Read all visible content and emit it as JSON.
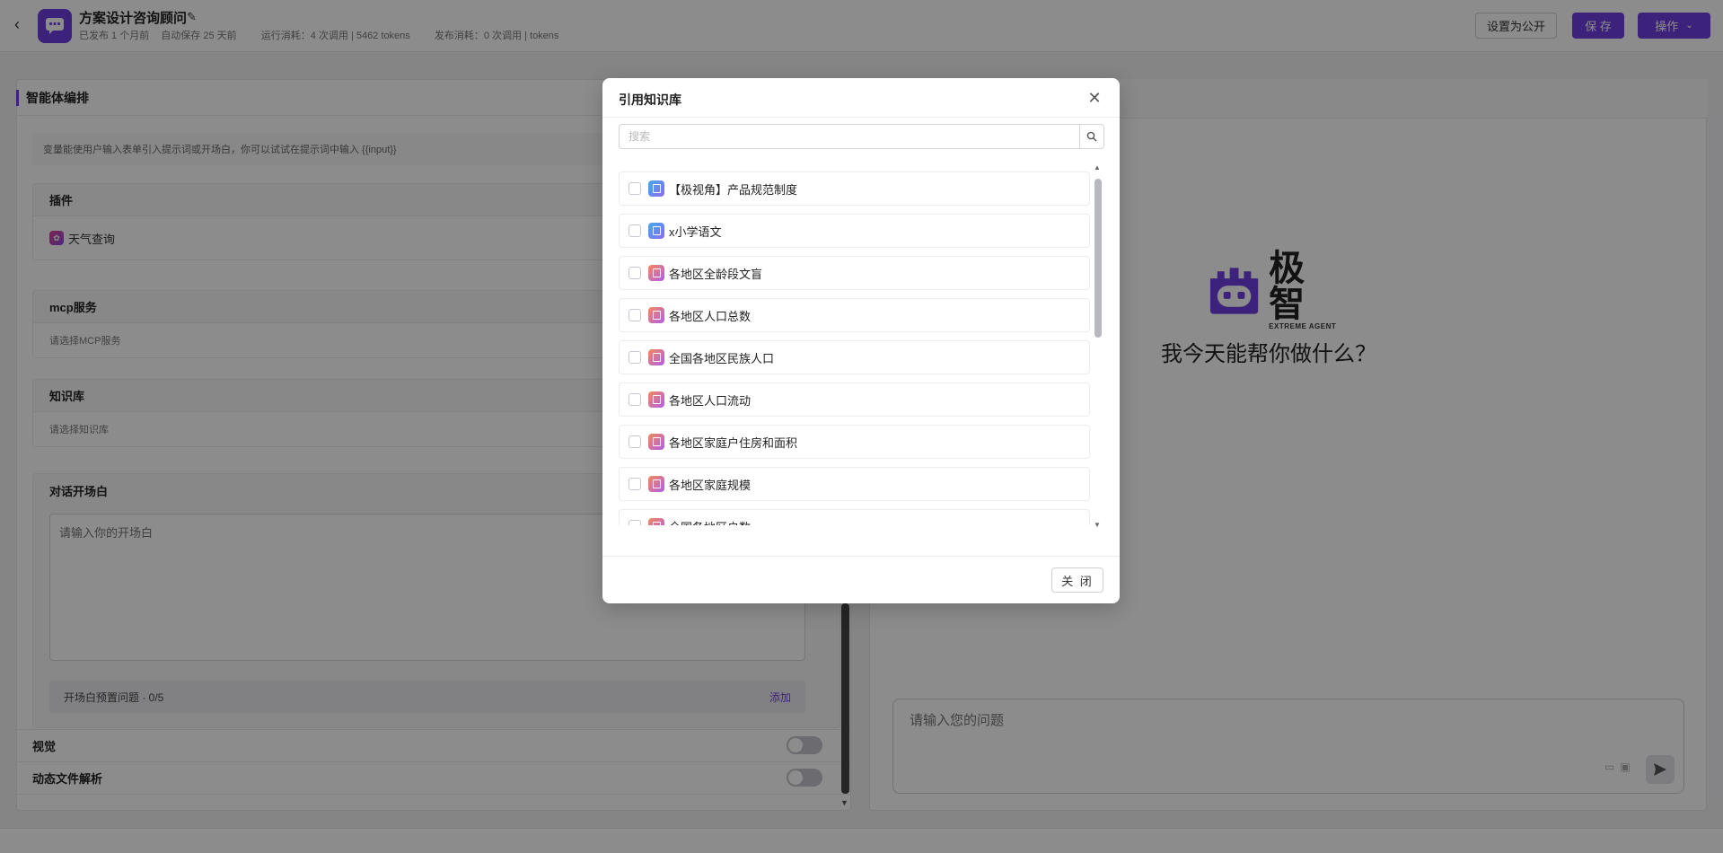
{
  "header": {
    "title": "方案设计咨询顾问",
    "published": "已发布 1 个月前",
    "autosave": "自动保存 25 天前",
    "run_cost": "运行消耗：4 次调用 | 5462 tokens",
    "publish_cost": "发布消耗：0 次调用 | tokens",
    "public_label": "设置为公开",
    "save_label": "保 存",
    "ops_label": "操作"
  },
  "left": {
    "title": "智能体编排",
    "hint": "变量能使用户输入表单引入提示词或开场白，你可以试试在提示词中输入 {{input}}",
    "plugins": {
      "title": "插件",
      "item": "天气查询"
    },
    "mcp": {
      "title": "mcp服务",
      "placeholder": "请选择MCP服务"
    },
    "knowledge": {
      "title": "知识库",
      "placeholder": "请选择知识库"
    },
    "opener": {
      "title": "对话开场白",
      "placeholder": "请输入你的开场白",
      "preset": "开场白预置问题 · 0/5",
      "add": "添加"
    },
    "vision": "视觉",
    "file_parse": "动态文件解析"
  },
  "right": {
    "logo_cn": "极智",
    "logo_en": "EXTREME AGENT",
    "welcome": "我今天能帮你做什么？",
    "chat_placeholder": "请输入您的问题"
  },
  "modal": {
    "title": "引用知识库",
    "search_placeholder": "搜索",
    "close_label": "关 闭",
    "items": [
      {
        "label": "【极视角】产品规范制度",
        "kind": "doc"
      },
      {
        "label": "x小学语文",
        "kind": "doc"
      },
      {
        "label": "各地区全龄段文盲",
        "kind": "data"
      },
      {
        "label": "各地区人口总数",
        "kind": "data"
      },
      {
        "label": "全国各地区民族人口",
        "kind": "data"
      },
      {
        "label": "各地区人口流动",
        "kind": "data"
      },
      {
        "label": "各地区家庭户住房和面积",
        "kind": "data"
      },
      {
        "label": "各地区家庭规模",
        "kind": "data"
      },
      {
        "label": "全国各地区户数",
        "kind": "data"
      }
    ]
  },
  "colors": {
    "accent": "#6d3fe0"
  }
}
